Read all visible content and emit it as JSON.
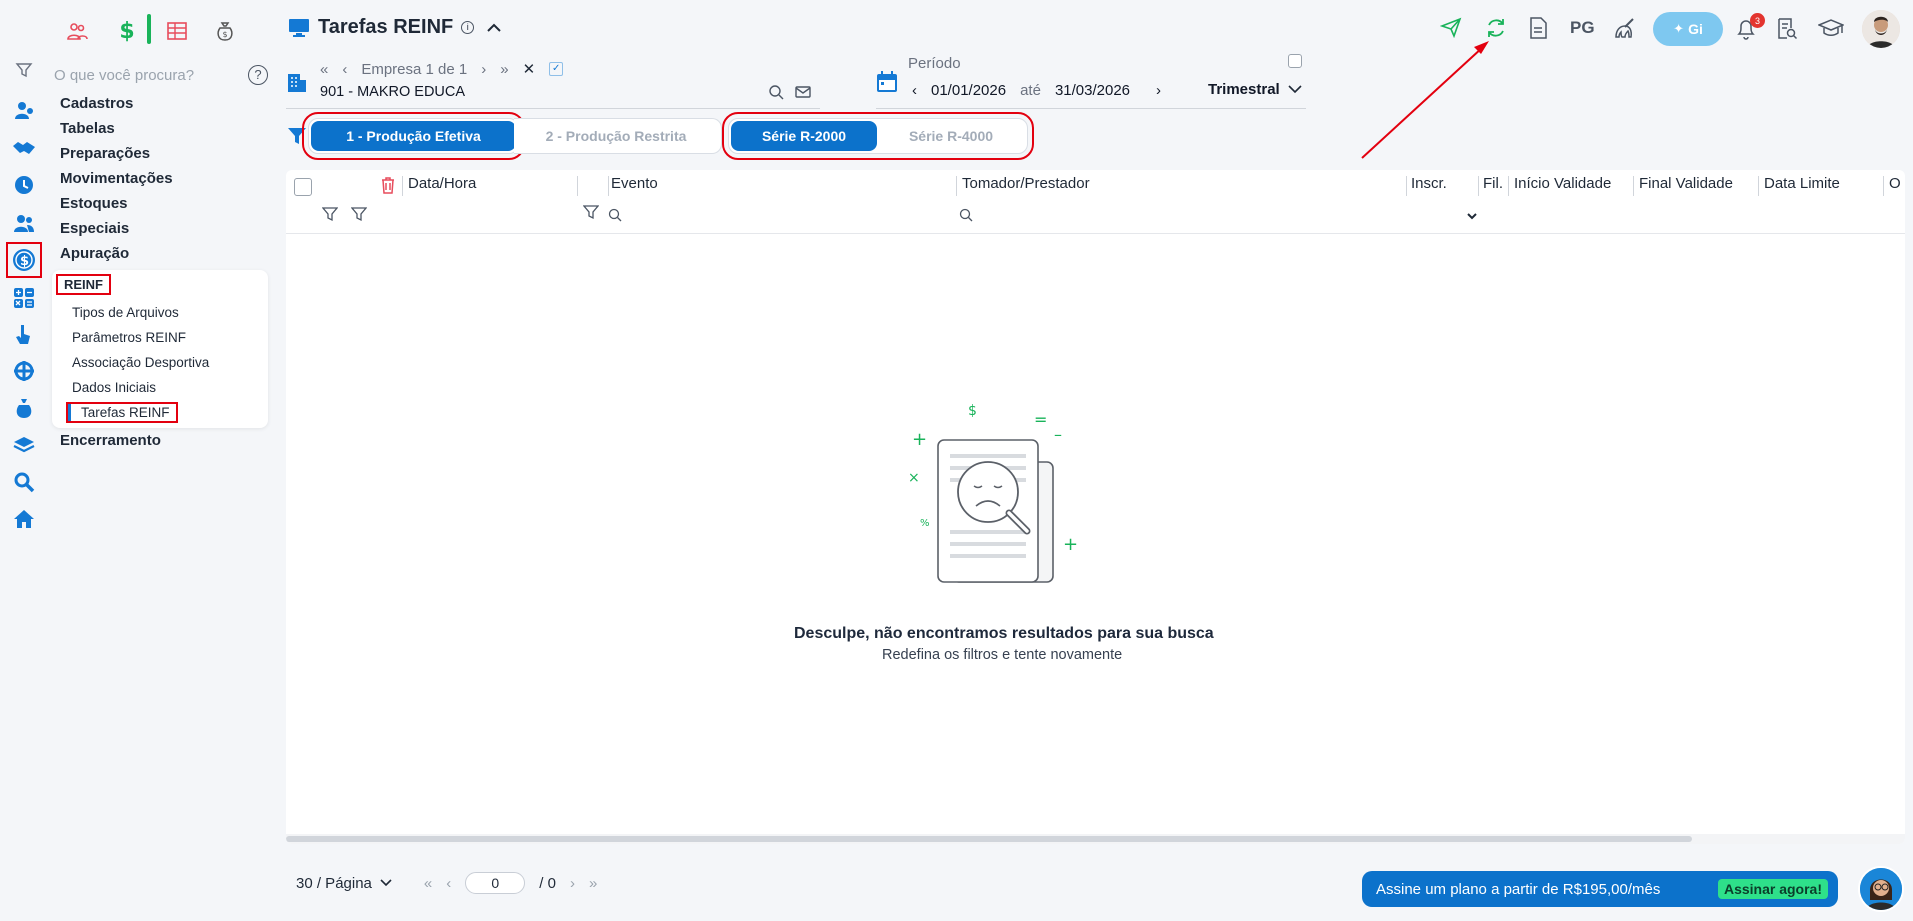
{
  "search": {
    "placeholder": "O que você procura?"
  },
  "sidebar": {
    "items": [
      {
        "label": "Cadastros"
      },
      {
        "label": "Tabelas"
      },
      {
        "label": "Preparações"
      },
      {
        "label": "Movimentações"
      },
      {
        "label": "Estoques"
      },
      {
        "label": "Especiais"
      },
      {
        "label": "Apuração"
      }
    ],
    "submenu_title": "REINF",
    "submenu": [
      {
        "label": "Tipos de Arquivos"
      },
      {
        "label": "Parâmetros REINF"
      },
      {
        "label": "Associação Desportiva"
      },
      {
        "label": "Dados Iniciais"
      },
      {
        "label": "Tarefas REINF"
      }
    ],
    "after": {
      "label": "Encerramento"
    }
  },
  "header": {
    "title": "Tarefas REINF",
    "pg_label": "PG",
    "gi_label": "Gi",
    "notif_count": "3"
  },
  "empresa": {
    "nav_label": "Empresa 1 de 1",
    "name": "901 - MAKRO EDUCA"
  },
  "periodo": {
    "label": "Período",
    "start": "01/01/2026",
    "between": "até",
    "end": "31/03/2026",
    "range_type": "Trimestral"
  },
  "production": {
    "options": [
      "1 - Produção Efetiva",
      "2 - Produção Restrita"
    ],
    "selected": 0
  },
  "series": {
    "options": [
      "Série R-2000",
      "Série R-4000"
    ],
    "selected": 0
  },
  "table": {
    "columns": [
      "Data/Hora",
      "Evento",
      "Tomador/Prestador",
      "Inscr.",
      "Fil.",
      "Início Validade",
      "Final Validade",
      "Data Limite",
      "O"
    ],
    "rows": []
  },
  "empty_state": {
    "title": "Desculpe, não encontramos resultados para sua busca",
    "subtitle": "Redefina os filtros e tente novamente"
  },
  "pagination": {
    "per_page": "30 / Página",
    "current_page": "0",
    "total": "/ 0"
  },
  "promo": {
    "text": "Assine um plano a partir de R$195,00/mês",
    "cta": "Assinar agora!"
  },
  "colors": {
    "primary": "#0c72cb",
    "annotation": "#e3000f",
    "accent_green": "#19b35a"
  }
}
